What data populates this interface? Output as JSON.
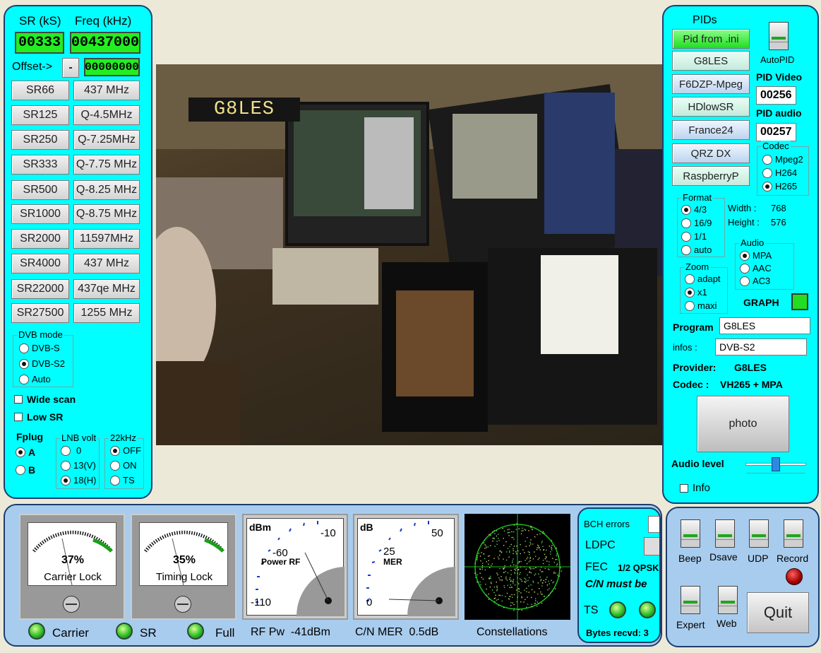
{
  "left": {
    "sr_label": "SR (kS)",
    "freq_label": "Freq (kHz)",
    "sr_value": "00333",
    "freq_value": "00437000",
    "offset_label": "Offset->",
    "offset_sign": "-",
    "offset_value": "00000000",
    "sr_buttons": [
      "SR66",
      "SR125",
      "SR250",
      "SR333",
      "SR500",
      "SR1000",
      "SR2000",
      "SR4000",
      "SR22000",
      "SR27500"
    ],
    "freq_buttons": [
      "437 MHz",
      "Q-4.5MHz",
      "Q-7.25MHz",
      "Q-7.75 MHz",
      "Q-8.25 MHz",
      "Q-8.75 MHz",
      "11597MHz",
      "437 MHz",
      "437qe MHz",
      "1255 MHz"
    ],
    "dvb_title": "DVB mode",
    "dvb_options": [
      "DVB-S",
      "DVB-S2",
      "Auto"
    ],
    "wide_scan": "Wide scan",
    "low_sr": "Low SR",
    "fplug_title": "Fplug",
    "fplug_options": [
      "A",
      "B"
    ],
    "lnb_title": "LNB volt",
    "lnb_options": [
      "0",
      "13(V)",
      "18(H)"
    ],
    "k22_title": "22kHz",
    "k22_options": [
      "OFF",
      "ON",
      "TS"
    ]
  },
  "video": {
    "overlay_text": "G8LES"
  },
  "right": {
    "pids_title": "PIDs",
    "pid_buttons": [
      "Pid from .ini",
      "G8LES",
      "F6DZP-Mpeg",
      "HDlowSR",
      "France24",
      "QRZ DX",
      "RaspberryP"
    ],
    "autopid": "AutoPID",
    "pid_video_label": "PID Video",
    "pid_video": "00256",
    "pid_audio_label": "PID audio",
    "pid_audio": "00257",
    "codec_title": "Codec",
    "codec_options": [
      "Mpeg2",
      "H264",
      "H265"
    ],
    "format_title": "Format",
    "format_options": [
      "4/3",
      "16/9",
      "1/1",
      "auto"
    ],
    "width_label": "Width :",
    "width_value": "768",
    "height_label": "Height :",
    "height_value": "576",
    "audio_title": "Audio",
    "audio_options": [
      "MPA",
      "AAC",
      "AC3"
    ],
    "zoom_title": "Zoom",
    "zoom_options": [
      "adapt",
      "x1",
      "maxi"
    ],
    "graph_label": "GRAPH",
    "program_label": "Program",
    "program_value": "G8LES",
    "infos_label": "infos :",
    "infos_value": "DVB-S2",
    "provider_label": "Provider:",
    "provider_value": "G8LES",
    "codec_label": "Codec :",
    "codec_value": "VH265 + MPA",
    "photo": "photo",
    "audio_level_label": "Audio level",
    "audio_level": 0.5,
    "info": "Info"
  },
  "bottom": {
    "carrier_pct": "37%",
    "carrier_label": "Carrier Lock",
    "timing_pct": "35%",
    "timing_label": "Timing Lock",
    "dbm_unit": "dBm",
    "dbm_ticks": [
      "-10",
      "-60",
      "-110"
    ],
    "power_rf_label": "Power RF",
    "db_unit": "dB",
    "db_ticks": [
      "50",
      "25",
      "0"
    ],
    "mer_label": "MER",
    "bch_errors": "BCH errors",
    "ldpc": "LDPC",
    "fec_label": "FEC",
    "fec_value": "1/2 QPSK",
    "cn_must_be": "C/N must be",
    "ts_label": "TS",
    "bytes_recvd": "Bytes recvd:",
    "bytes_value": "3",
    "leds": [
      "Carrier",
      "SR",
      "Full"
    ],
    "rf_pw_label": "RF Pw",
    "rf_pw_value": "-41dBm",
    "cn_mer_label": "C/N MER",
    "cn_mer_value": "0.5dB",
    "constellations": "Constellations"
  },
  "controls": {
    "switches": [
      "Beep",
      "Dsave",
      "UDP",
      "Record",
      "Expert",
      "Web"
    ],
    "quit": "Quit"
  }
}
